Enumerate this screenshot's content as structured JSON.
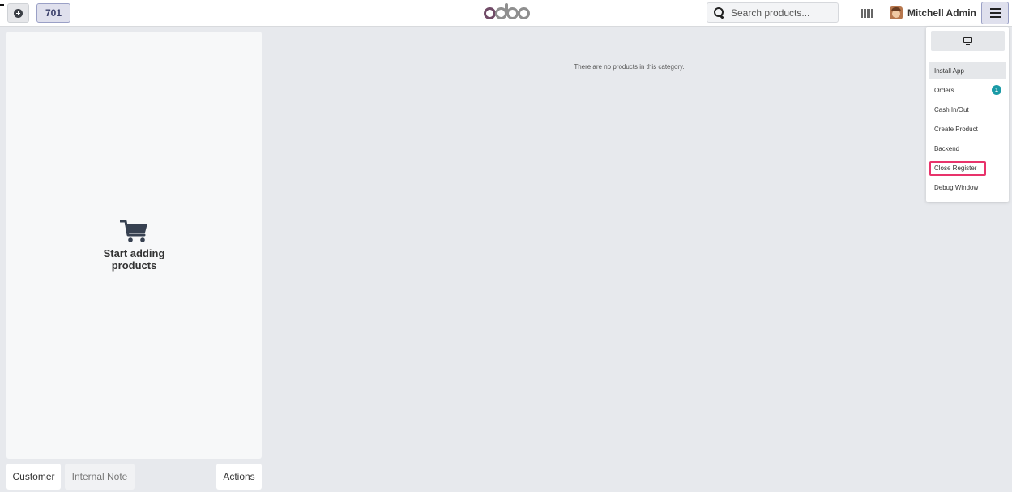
{
  "header": {
    "order_number": "701",
    "logo_text": "odoo",
    "search_placeholder": "Search products...",
    "user_name": "Mitchell Admin"
  },
  "order_panel": {
    "empty_text_line1": "Start adding",
    "empty_text_line2": "products",
    "customer_label": "Customer",
    "note_label": "Internal Note",
    "actions_label": "Actions"
  },
  "products": {
    "empty_message": "There are no products in this category."
  },
  "menu": {
    "items": [
      {
        "label": "Install App"
      },
      {
        "label": "Orders",
        "badge": "1"
      },
      {
        "label": "Cash In/Out"
      },
      {
        "label": "Create Product"
      },
      {
        "label": "Backend"
      },
      {
        "label": "Close Register"
      },
      {
        "label": "Debug Window"
      }
    ]
  },
  "colors": {
    "brand": "#714b67",
    "badge": "#1a9aa6",
    "highlight": "#e8336b",
    "active_button": "#dfe0ed"
  },
  "icons": {
    "add_order": "plus-circle-icon",
    "search": "search-icon",
    "barcode": "barcode-icon",
    "menu": "hamburger-icon",
    "screen": "monitor-icon",
    "cart": "shopping-cart-icon"
  }
}
